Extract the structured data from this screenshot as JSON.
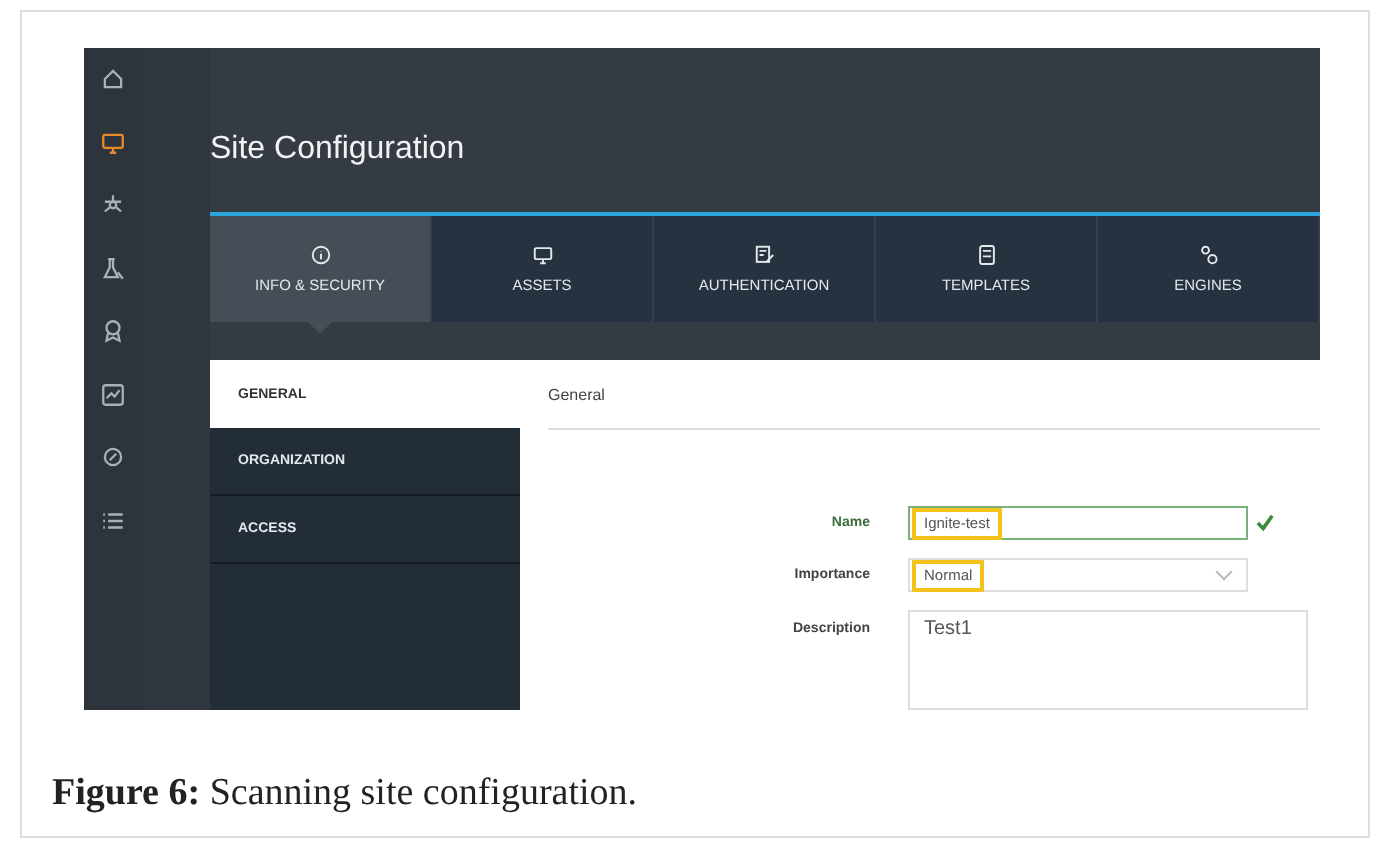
{
  "nav_icons": [
    {
      "kind": "home",
      "selected": false
    },
    {
      "kind": "monitor",
      "selected": true
    },
    {
      "kind": "biohazard",
      "selected": false
    },
    {
      "kind": "flask",
      "selected": false
    },
    {
      "kind": "award",
      "selected": false
    },
    {
      "kind": "chart",
      "selected": false
    },
    {
      "kind": "link",
      "selected": false
    },
    {
      "kind": "list",
      "selected": false
    }
  ],
  "page_title": "Site Configuration",
  "tabs": [
    {
      "kind": "info",
      "label": "INFO & SECURITY",
      "selected": true
    },
    {
      "kind": "monitor",
      "label": "ASSETS",
      "selected": false
    },
    {
      "kind": "edit",
      "label": "AUTHENTICATION",
      "selected": false
    },
    {
      "kind": "template",
      "label": "TEMPLATES",
      "selected": false
    },
    {
      "kind": "gears",
      "label": "ENGINES",
      "selected": false
    }
  ],
  "sections": [
    {
      "label": "GENERAL",
      "selected": true
    },
    {
      "label": "ORGANIZATION",
      "selected": false
    },
    {
      "label": "ACCESS",
      "selected": false
    }
  ],
  "panel_title": "General",
  "form": [
    {
      "kind": "text",
      "label": "Name",
      "value": "Ignite-test",
      "valid": true,
      "highlighted": true
    },
    {
      "kind": "select",
      "label": "Importance",
      "value": "Normal",
      "highlighted": true
    },
    {
      "kind": "textarea",
      "label": "Description",
      "value": "Test1"
    }
  ],
  "caption": "**Figure 6:** Scanning site configuration."
}
